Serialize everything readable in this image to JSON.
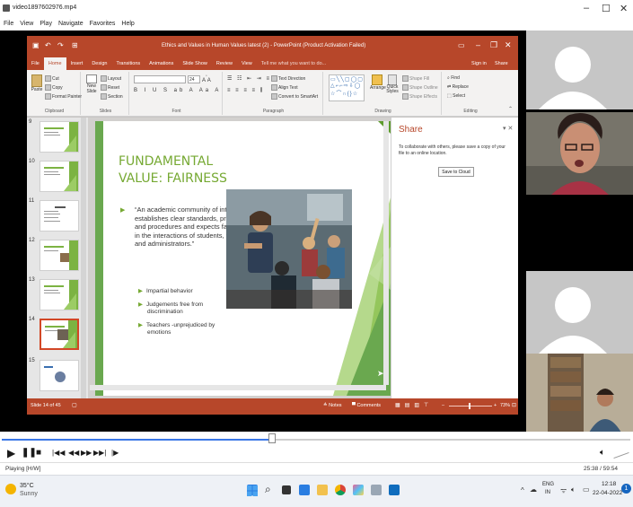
{
  "player": {
    "window_title": "video1897602976.mp4",
    "menu": [
      "File",
      "View",
      "Play",
      "Navigate",
      "Favorites",
      "Help"
    ],
    "window_controls": [
      "–",
      "☐",
      "✕"
    ],
    "status_left": "Playing [H/W]",
    "time": "25:38 / 59:54",
    "controls": [
      "play-icon",
      "pause-icon",
      "stop-icon",
      "prev-chapter-icon",
      "rewind-icon",
      "forward-icon",
      "next-chapter-icon",
      "frame-step-icon"
    ],
    "progress_fraction": 0.43
  },
  "powerpoint": {
    "title": "Ethics and Values in Human Values latest (2) - PowerPoint (Product Activation Failed)",
    "signin": "Sign in",
    "share": "Share",
    "tabs": [
      "File",
      "Home",
      "Insert",
      "Design",
      "Transitions",
      "Animations",
      "Slide Show",
      "Review",
      "View",
      "Tell me what you want to do..."
    ],
    "active_tab": "Home",
    "ribbon": {
      "clipboard": {
        "paste": "Paste",
        "cut": "Cut",
        "copy": "Copy",
        "format_painter": "Format Painter",
        "label": "Clipboard"
      },
      "slides": {
        "new_slide": "New Slide",
        "layout": "Layout",
        "reset": "Reset",
        "section": "Section",
        "label": "Slides"
      },
      "font": {
        "size": "24",
        "label": "Font"
      },
      "paragraph": {
        "text_direction": "Text Direction",
        "align_text": "Align Text",
        "smartart": "Convert to SmartArt",
        "label": "Paragraph"
      },
      "drawing": {
        "arrange": "Arrange",
        "quick_styles": "Quick Styles",
        "shape_fill": "Shape Fill",
        "shape_outline": "Shape Outline",
        "shape_effects": "Shape Effects",
        "label": "Drawing"
      },
      "editing": {
        "find": "Find",
        "replace": "Replace",
        "select": "Select",
        "label": "Editing"
      }
    },
    "thumbnails": [
      {
        "num": "9"
      },
      {
        "num": "10"
      },
      {
        "num": "11"
      },
      {
        "num": "12"
      },
      {
        "num": "13"
      },
      {
        "num": "14",
        "selected": true
      },
      {
        "num": "15"
      }
    ],
    "slide": {
      "title_line1": "FUNDAMENTAL",
      "title_line2": "VALUE: FAIRNESS",
      "quote": "“An academic community of integrity establishes clear standards, practices, and procedures and expects fairness in the interactions of students, faculty, and administrators.”",
      "bullets": [
        "Impartial behavior",
        "Judgements free from discrimination",
        "Teachers -unprejudiced by emotions"
      ]
    },
    "share_pane": {
      "title": "Share",
      "message": "To collaborate with others, please save a copy of your file to an online location.",
      "button": "Save to Cloud"
    },
    "status": {
      "slide_of": "Slide 14 of 45",
      "notes": "Notes",
      "comments": "Comments",
      "zoom": "73%"
    },
    "accent_color": "#b7472a",
    "slide_green": "#76a933"
  },
  "taskbar": {
    "weather_temp": "35°C",
    "weather_desc": "Sunny",
    "lang_top": "ENG",
    "lang_bottom": "IN",
    "clock_time": "12:18",
    "clock_date": "22-04-2022",
    "notification_count": "1",
    "apps": [
      "windows-start-icon",
      "search-icon",
      "task-view-icon",
      "widgets-icon",
      "file-explorer-icon",
      "chrome-icon",
      "photos-icon",
      "store-icon",
      "outlook-icon"
    ]
  }
}
